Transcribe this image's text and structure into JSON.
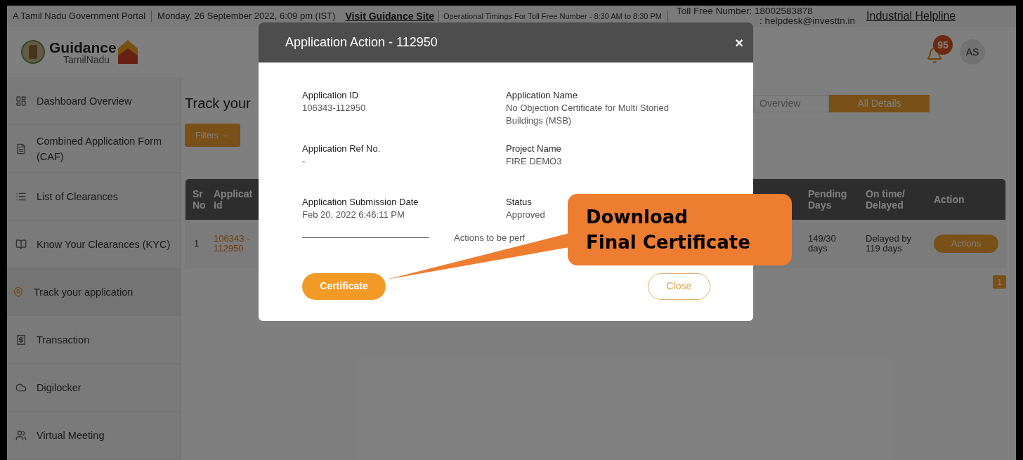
{
  "top_bar": {
    "portal": "A Tamil Nadu Government Portal",
    "date": "Monday, 26 September 2022, 6:09 pm (IST)",
    "guidance_link": "Visit Guidance Site",
    "timings": "Operational Timings For Toll Free Number - 8:30 AM to 8:30 PM",
    "toll_free": "Toll Free Number: 18002583878",
    "email": ": helpdesk@investtn.in",
    "helpline_link": "Industrial Helpline"
  },
  "header": {
    "logo_title": "Guidance",
    "logo_subtitle": "TamilNadu",
    "notification_count": "95",
    "avatar": "AS"
  },
  "sidebar": {
    "items": [
      {
        "label": "Dashboard Overview",
        "selected": false
      },
      {
        "label": "Combined Application Form (CAF)",
        "selected": false
      },
      {
        "label": "List of Clearances",
        "selected": false
      },
      {
        "label": "Know Your Clearances (KYC)",
        "selected": false
      },
      {
        "label": "Track your application",
        "selected": true
      },
      {
        "label": "Transaction",
        "selected": false
      },
      {
        "label": "Digilocker",
        "selected": false
      },
      {
        "label": "Virtual Meeting",
        "selected": false
      }
    ]
  },
  "page": {
    "title": "Track your",
    "filters": "Filters",
    "tabs": [
      {
        "label": "Overview",
        "selected": false
      },
      {
        "label": "All Details",
        "selected": true
      }
    ],
    "table": {
      "columns": [
        "Sr No",
        "Applicat Id",
        "Pending Days",
        "On time/ Delayed",
        "Action"
      ],
      "rows": [
        {
          "sr": "1",
          "application_id": "106343 - 112950",
          "pending_days": "149/30 days",
          "timeliness": "Delayed by 119 days",
          "action": "Actions"
        }
      ]
    },
    "pagination": "1"
  },
  "modal": {
    "title": "Application Action - 112950",
    "close": "×",
    "fields": [
      {
        "label": "Application ID",
        "value": "106343-112950"
      },
      {
        "label": "Application Name",
        "value": "No Objection Certificate for Multi Storied Buildings (MSB)"
      },
      {
        "label": "Application Ref No.",
        "value": "-"
      },
      {
        "label": "Project Name",
        "value": "FIRE DEMO3"
      },
      {
        "label": "Application Submission Date",
        "value": "Feb 20, 2022 6:46:11 PM"
      },
      {
        "label": "Status",
        "value": "Approved"
      }
    ],
    "actions_label": "Actions to be perf",
    "certificate_button": "Certificate",
    "close_button": "Close"
  },
  "callout": {
    "lines": [
      "Download",
      "Final Certificate"
    ]
  }
}
